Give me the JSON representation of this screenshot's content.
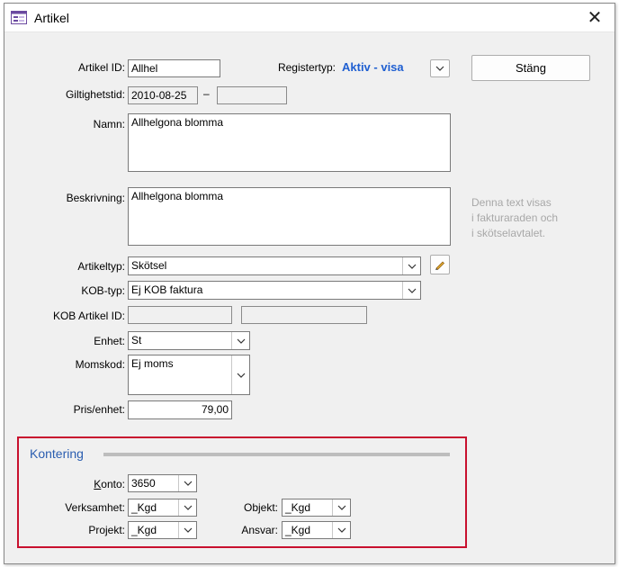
{
  "window": {
    "title": "Artikel"
  },
  "toolbar": {
    "close_label": "Stäng"
  },
  "labels": {
    "artikel_id": "Artikel ID:",
    "registertyp": "Registertyp:",
    "giltighetstid": "Giltighetstid:",
    "date_separator": "–",
    "namn": "Namn:",
    "beskrivning": "Beskrivning:",
    "artikeltyp": "Artikeltyp:",
    "kob_typ": "KOB-typ:",
    "kob_artikel_id": "KOB Artikel ID:",
    "enhet": "Enhet:",
    "momskod": "Momskod:",
    "pris_enhet": "Pris/enhet:"
  },
  "values": {
    "artikel_id": "Allhel",
    "registertyp": "Aktiv - visa",
    "giltig_from": "2010-08-25",
    "giltig_to": "",
    "namn": "Allhelgona blomma",
    "beskrivning": "Allhelgona blomma",
    "artikeltyp": "Skötsel",
    "kob_typ": "Ej KOB faktura",
    "kob_artikel_id_1": "",
    "kob_artikel_id_2": "",
    "enhet": "St",
    "momskod": "Ej moms",
    "pris_enhet": "79,00"
  },
  "hint": {
    "line1": "Denna text visas",
    "line2": "i fakturaraden och",
    "line3": "i skötselavtalet."
  },
  "kontering": {
    "title": "Kontering",
    "konto_label": "Konto:",
    "konto_value": "3650",
    "verksamhet_label": "Verksamhet:",
    "verksamhet_value": "_Kgd",
    "objekt_label": "Objekt:",
    "objekt_value": "_Kgd",
    "projekt_label": "Projekt:",
    "projekt_value": "_Kgd",
    "ansvar_label": "Ansvar:",
    "ansvar_value": "_Kgd"
  },
  "colors": {
    "accent_blue": "#1f5fd1",
    "section_title": "#2a5db0",
    "highlight_frame": "#c8102e",
    "window_bg": "#f0f0f0"
  },
  "icons": {
    "app": "form-window-icon",
    "close": "close-icon",
    "dropdown": "chevron-down-icon",
    "edit": "pencil-icon"
  }
}
